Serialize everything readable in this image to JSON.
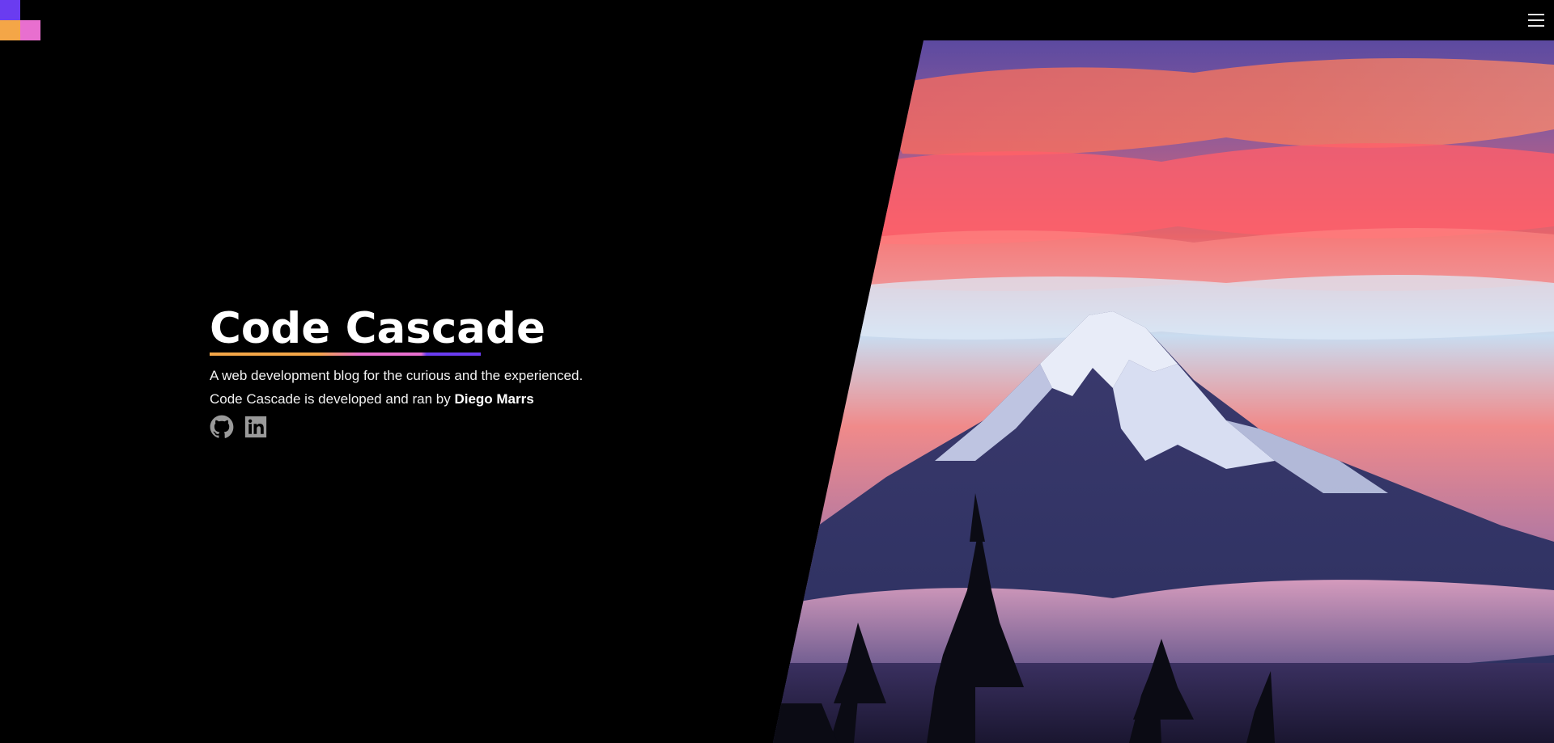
{
  "header": {
    "logo_colors": [
      "#6a3cf0",
      "#f4a647",
      "#e86fcf"
    ],
    "menu_icon": "hamburger-menu-icon"
  },
  "hero": {
    "title": "Code Cascade",
    "title_underline_colors": [
      "#f4a647",
      "#e86fcf",
      "#6a3cf0"
    ],
    "tagline": "A web development blog for the curious and the experienced.",
    "credit_prefix": "Code Cascade is developed and ran by ",
    "author": "Diego Marrs",
    "image_subject": "snow-capped mountain at sunset with pine trees",
    "socials": [
      {
        "icon": "github-icon"
      },
      {
        "icon": "linkedin-icon"
      }
    ]
  },
  "colors": {
    "background": "#000000",
    "text": "#ffffff",
    "icon_gray": "#9a9a9a"
  }
}
